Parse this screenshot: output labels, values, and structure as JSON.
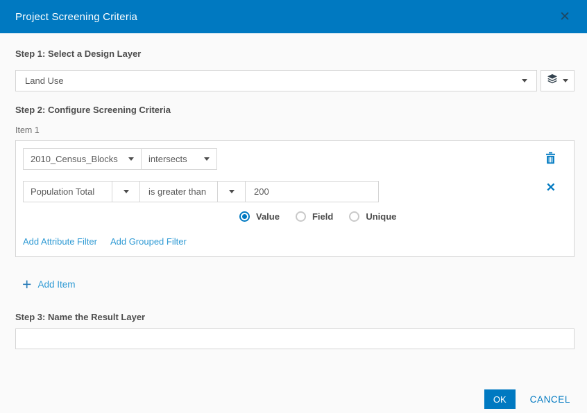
{
  "colors": {
    "header_bg": "#0079c1",
    "accent_blue": "#0079c1",
    "link_blue": "#2f9ad4",
    "ok_button_bg": "#0079c1",
    "body_bg": "#fafafa",
    "border": "#d5d5d5"
  },
  "header": {
    "title": "Project Screening Criteria"
  },
  "icons": {
    "close": "✕",
    "remove": "✕",
    "add": "+"
  },
  "step1": {
    "label": "Step 1: Select a Design Layer",
    "layer_select_value": "Land Use"
  },
  "step2": {
    "label": "Step 2: Configure Screening Criteria",
    "item_label": "Item 1",
    "screening_row": {
      "layer": "2010_Census_Blocks",
      "operator": "intersects"
    },
    "attribute_row": {
      "field": "Population Total",
      "operator": "is greater than",
      "value": "200"
    },
    "radio_options": [
      {
        "label": "Value",
        "selected": true
      },
      {
        "label": "Field",
        "selected": false
      },
      {
        "label": "Unique",
        "selected": false
      }
    ],
    "add_attribute_filter": "Add Attribute Filter",
    "add_grouped_filter": "Add Grouped Filter",
    "add_item": "Add Item"
  },
  "step3": {
    "label": "Step 3: Name the Result Layer",
    "input_value": ""
  },
  "footer": {
    "ok": "OK",
    "cancel": "CANCEL"
  }
}
